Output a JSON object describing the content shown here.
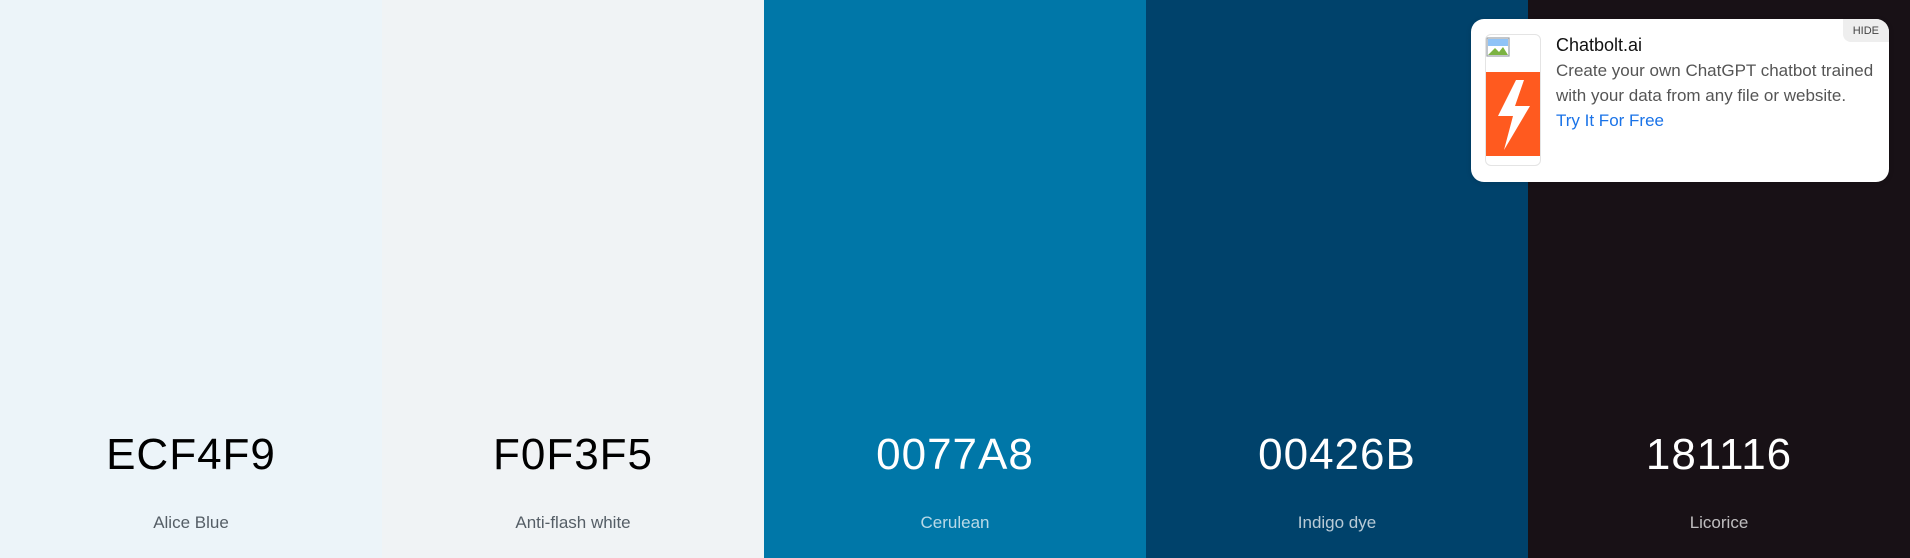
{
  "palette": {
    "swatches": [
      {
        "hex": "ECF4F9",
        "name": "Alice Blue",
        "color": "#ECF4F9",
        "tone": "light"
      },
      {
        "hex": "F0F3F5",
        "name": "Anti-flash white",
        "color": "#F0F3F5",
        "tone": "light"
      },
      {
        "hex": "0077A8",
        "name": "Cerulean",
        "color": "#0077A8",
        "tone": "dark"
      },
      {
        "hex": "00426B",
        "name": "Indigo dye",
        "color": "#00426B",
        "tone": "dark"
      },
      {
        "hex": "181116",
        "name": "Licorice",
        "color": "#181116",
        "tone": "dark"
      }
    ]
  },
  "ad": {
    "hide_label": "HIDE",
    "title": "Chatbolt.ai",
    "body": "Create your own ChatGPT chatbot trained with your data from any file or website.",
    "cta": "Try It For Free",
    "logo_icon": "lightning-bolt-icon",
    "logo_color": "#FF5A1F",
    "cta_color": "#1A73E8"
  }
}
